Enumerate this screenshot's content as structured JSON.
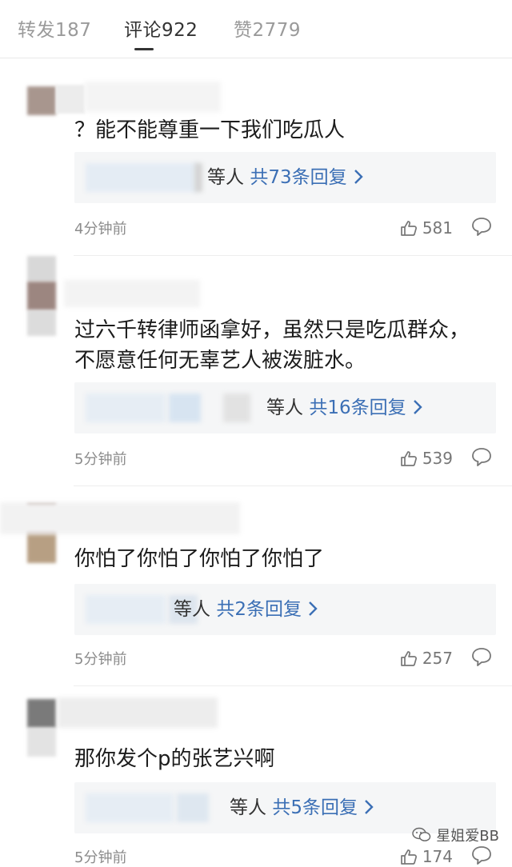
{
  "tabs": [
    {
      "label": "转发187"
    },
    {
      "label": "评论922"
    },
    {
      "label": "赞2779"
    }
  ],
  "comments": [
    {
      "text": "？能不能尊重一下我们吃瓜人",
      "reply_suffix": "等人",
      "reply_count": "共73条回复",
      "time": "4分钟前",
      "likes": "581"
    },
    {
      "text": "过六千转律师函拿好，虽然只是吃瓜群众，不愿意任何无辜艺人被泼脏水。",
      "reply_suffix": "等人",
      "reply_count": "共16条回复",
      "time": "5分钟前",
      "likes": "539"
    },
    {
      "text": "你怕了你怕了你怕了你怕了",
      "reply_suffix": "等人",
      "reply_count": "共2条回复",
      "time": "5分钟前",
      "likes": "257"
    },
    {
      "text": "那你发个p的张艺兴啊",
      "reply_suffix": "等人",
      "reply_count": "共5条回复",
      "time": "5分钟前",
      "likes": "174"
    }
  ],
  "watermark": {
    "text": "星姐爱BB"
  },
  "icons": {
    "like": "thumbs-up-icon",
    "reply": "speech-bubble-icon",
    "chevron": "chevron-right-icon"
  },
  "colors": {
    "reply_link": "#3b6fb5",
    "meta": "#8c8c8c",
    "tab_active": "#333333",
    "tab_inactive": "#9a9a9a"
  }
}
